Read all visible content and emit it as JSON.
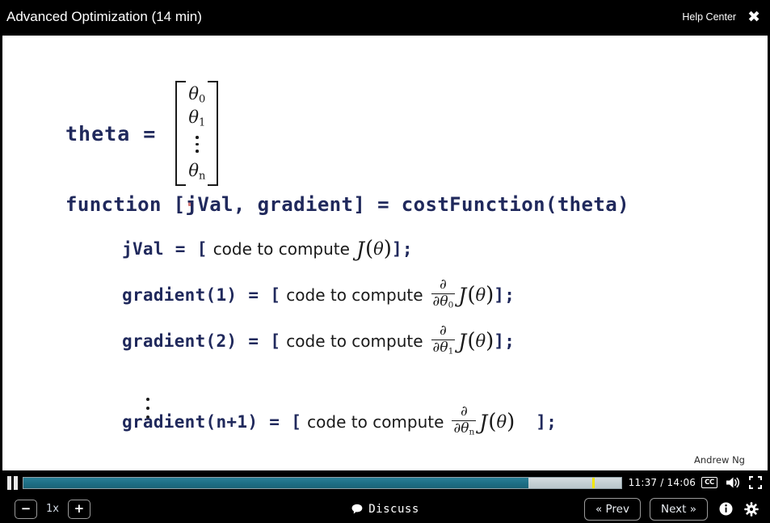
{
  "topbar": {
    "title": "Advanced Optimization (14 min)",
    "help_center_label": "Help Center",
    "close_icon": "close-x-icon"
  },
  "slide": {
    "theta_assignment": {
      "variable_label": "theta",
      "equals": "=",
      "matrix_rows": [
        "θ0",
        "θ1",
        "⋮",
        "θn"
      ]
    },
    "function_signature": "function [jVal, gradient] = costFunction(theta)",
    "lines": [
      {
        "lhs": "jVal",
        "equals": "=",
        "open_bracket": "[",
        "prose": "code to compute",
        "derivative_numerator": "",
        "derivative_denominator": "",
        "cost_symbol": "J",
        "cost_arg": "θ",
        "close": "];"
      },
      {
        "lhs": "gradient(1)",
        "equals": "=",
        "open_bracket": "[",
        "prose": "code to compute",
        "derivative_numerator": "∂",
        "derivative_denominator": "∂θ0",
        "cost_symbol": "J",
        "cost_arg": "θ",
        "close": "];"
      },
      {
        "lhs": "gradient(2)",
        "equals": "=",
        "open_bracket": "[",
        "prose": "code to compute",
        "derivative_numerator": "∂",
        "derivative_denominator": "∂θ1",
        "cost_symbol": "J",
        "cost_arg": "θ",
        "close": "];"
      },
      {
        "lhs": "gradient(n+1)",
        "equals": "=",
        "open_bracket": "[",
        "prose": "code to compute",
        "derivative_numerator": "∂",
        "derivative_denominator": "∂θn",
        "cost_symbol": "J",
        "cost_arg": "θ",
        "close": "];"
      }
    ],
    "attribution": "Andrew Ng"
  },
  "player": {
    "play_state_icon": "pause-icon",
    "elapsed": "11:37",
    "duration": "14:06",
    "timecode": "11:37 / 14:06",
    "progress_percent": 84.5,
    "playhead_percent": 95.2,
    "cc_label": "CC",
    "volume_icon": "volume-icon",
    "fullscreen_icon": "fullscreen-icon",
    "played_color": "#1e6f86",
    "playhead_color": "#f2e800",
    "track_color": "#c3cfd3"
  },
  "controls": {
    "speed_decrease_label": "−",
    "speed_value": "1x",
    "speed_increase_label": "+",
    "discuss_label": "Discuss",
    "prev_label": "« Prev",
    "next_label": "Next »",
    "info_icon": "info-icon",
    "settings_icon": "gear-icon"
  }
}
